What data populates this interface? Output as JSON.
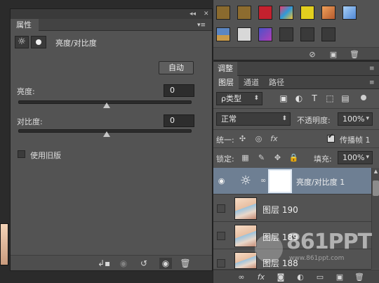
{
  "properties_panel": {
    "tab_label": "属性",
    "collapse_glyph": "◂◂",
    "close_glyph": "✕",
    "menu_glyph": "▾≡",
    "adjustment_title": "亮度/对比度",
    "auto_button": "自动",
    "brightness_label": "亮度:",
    "brightness_value": "0",
    "contrast_label": "对比度:",
    "contrast_value": "0",
    "legacy_label": "使用旧版",
    "legacy_checked": false,
    "footer_icons": [
      "clip-to-layer-icon",
      "view-previous-icon",
      "reset-icon",
      "visibility-icon",
      "trash-icon"
    ]
  },
  "styles_panel": {
    "swatch_colors": [
      [
        "#8a6a2e",
        "#8d6c2f",
        "#c4212e",
        "#2e9ad8",
        "#e3cf1e",
        "#d48a4f",
        "#6a9fe0"
      ],
      [
        "#6d7a8c",
        "#d8d8d8",
        "#7a3fb8",
        "#3a3a3a",
        "#3a3a3a",
        "#3a3a3a"
      ]
    ],
    "footer_icons": [
      "no-style-icon",
      "new-style-icon",
      "trash-icon"
    ]
  },
  "adjustments_header": {
    "tab_label": "调整",
    "menu_glyph": "≡"
  },
  "layers_panel": {
    "tabs": [
      "图层",
      "通道",
      "路径"
    ],
    "active_tab": "图层",
    "filter_kind": "ρ类型",
    "blend_mode": "正常",
    "opacity_label": "不透明度:",
    "opacity_value": "100%",
    "unify_label": "统一:",
    "propagate_label": "传播帧 1",
    "propagate_checked": true,
    "lock_label": "锁定:",
    "fill_label": "填充:",
    "fill_value": "100%",
    "layers": [
      {
        "name": "亮度/对比度 1",
        "type": "adjustment",
        "visible": true,
        "selected": true
      },
      {
        "name": "图层 190",
        "type": "image",
        "visible": false,
        "selected": false
      },
      {
        "name": "图层 189",
        "type": "image",
        "visible": false,
        "selected": false
      },
      {
        "name": "图层 188",
        "type": "image",
        "visible": false,
        "selected": false
      }
    ],
    "footer_icons": [
      "link-icon",
      "fx-icon",
      "add-mask-icon",
      "new-adjustment-icon",
      "folder-icon",
      "new-layer-icon",
      "trash-icon"
    ]
  },
  "watermark": {
    "brand": "861PPT",
    "url": "www.861ppt.com"
  }
}
